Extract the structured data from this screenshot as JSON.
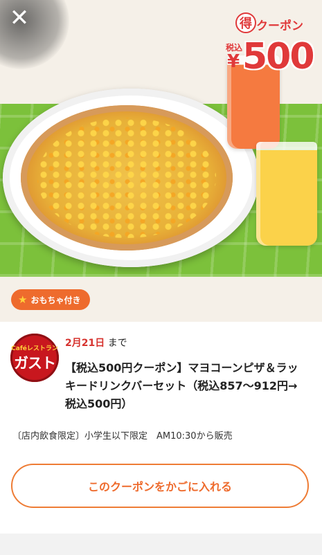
{
  "hero": {
    "close_icon": "close-icon",
    "badge": {
      "toku_char": "得",
      "label": "クーポン",
      "tax_label": "税込",
      "currency": "¥",
      "amount": "500",
      "color": "#e0393a"
    }
  },
  "tag": {
    "icon": "star-icon",
    "label": "おもちゃ付き",
    "color": "#ee6b2d"
  },
  "card": {
    "logo": {
      "top_text": "Caféレストラン",
      "brand": "ガスト",
      "color": "#c8171e"
    },
    "date": {
      "value": "2月21日",
      "suffix": "まで"
    },
    "title": "【税込500円クーポン】マヨコーンピザ＆ラッキードリンクバーセット（税込857〜912円→税込500円）",
    "note": "〔店内飲食限定〕小学生以下限定　AM10:30から販売",
    "cta_label": "このクーポンをかごに入れる"
  }
}
